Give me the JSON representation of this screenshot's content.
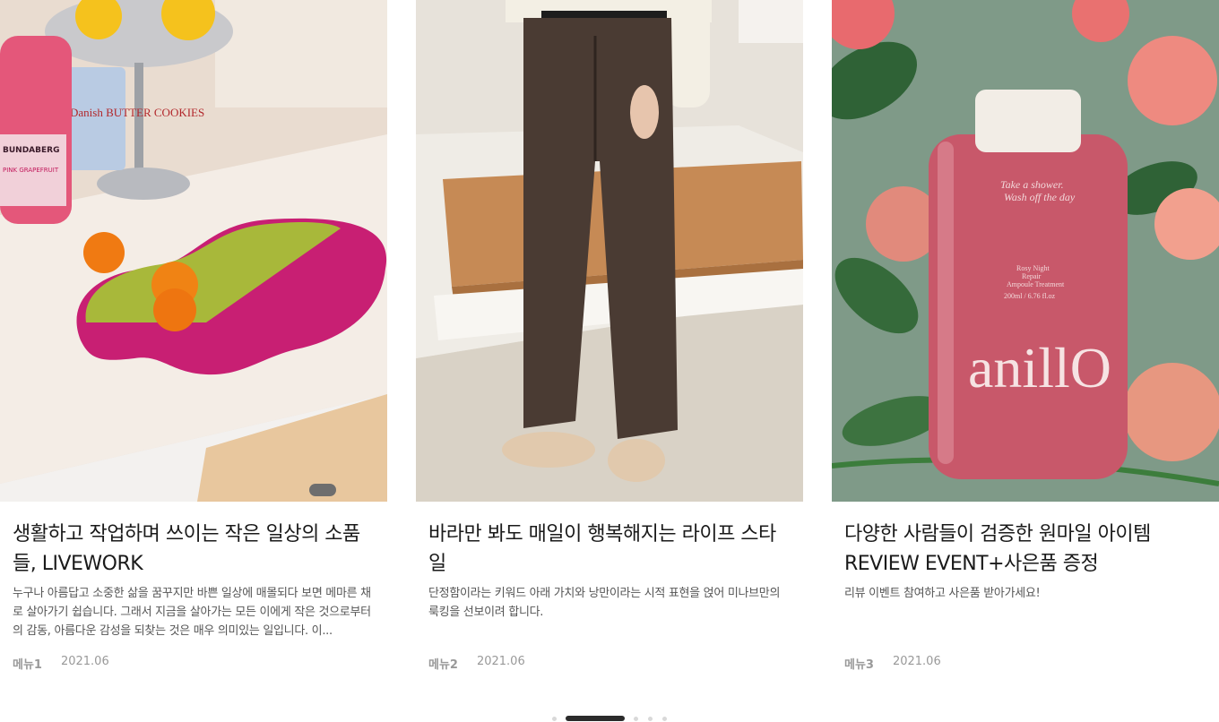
{
  "cards": [
    {
      "title": "생활하고 작업하며 쓰이는 작은 일상의 소품들, LIVEWORK",
      "description": "누구나 아름답고 소중한 삶을 꿈꾸지만 바쁜 일상에 매몰되다 보면 메마른 채로 살아가기 쉽습니다. 그래서 지금을 살아가는 모든 이에게 작은 것으로부터의 감동, 아름다운 감성을 되찾는 것은 매우 의미있는 일입니다. 이...",
      "menu": "메뉴1",
      "date": "2021.06",
      "image_icon": "tufted-rug-photo"
    },
    {
      "title": "바라만 봐도 매일이 행복해지는 라이프 스타일",
      "description": "단정함이라는 키워드 아래 가치와 낭만이라는 시적 표현을 얹어 미나브만의 룩킹을 선보이려 합니다.",
      "menu": "메뉴2",
      "date": "2021.06",
      "image_icon": "trousers-photo"
    },
    {
      "title": "다양한 사람들이 검증한 원마일 아이템 REVIEW EVENT+사은품 증정",
      "description": "리뷰 이벤트 참여하고 사은품 받아가세요!",
      "menu": "메뉴3",
      "date": "2021.06",
      "image_icon": "body-wash-bottle-photo"
    }
  ],
  "product_label": {
    "line1": "Take a shower.",
    "line2": "Wash off the day",
    "line3": "Rosy Night",
    "line4": "Repair",
    "line5": "Ampoule Treatment",
    "line6": "200ml / 6.76 fl.oz",
    "brand": "anillO"
  },
  "bottle_label": {
    "brand": "BUNDABERG",
    "flavor": "PINK GRAPEFRUIT",
    "cookie": "Danish BUTTER COOKIES"
  },
  "pagination": {
    "count": 5,
    "active_index": 1
  },
  "colors": {
    "active_dot": "#2b2b2b",
    "inactive_dot": "#d9d9d9"
  }
}
